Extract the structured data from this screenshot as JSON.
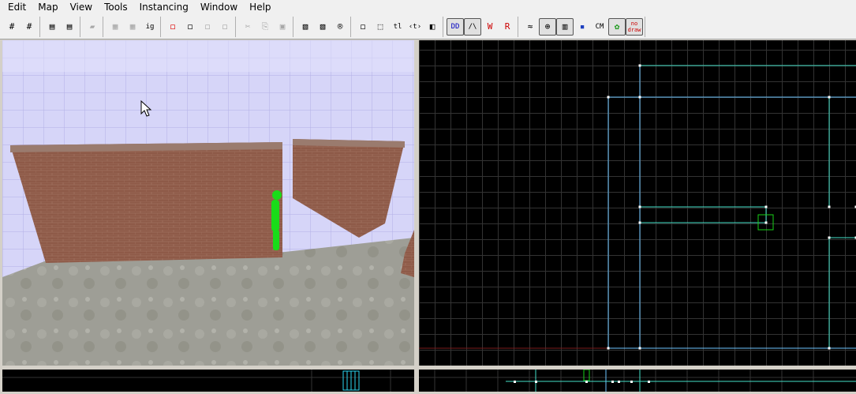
{
  "menubar": {
    "items": [
      "Edit",
      "Map",
      "View",
      "Tools",
      "Instancing",
      "Window",
      "Help"
    ]
  },
  "toolbar": {
    "groups": [
      [
        {
          "icon": "grid-toggle-icon",
          "glyph": "#",
          "state": "normal"
        },
        {
          "icon": "grid-increase-icon",
          "glyph": "#",
          "state": "normal"
        }
      ],
      [
        {
          "icon": "group-icon",
          "glyph": "▤",
          "state": "normal"
        },
        {
          "icon": "ungroup-icon",
          "glyph": "▤",
          "state": "normal"
        }
      ],
      [
        {
          "icon": "carve-icon",
          "glyph": "▰",
          "state": "disabled"
        }
      ],
      [
        {
          "icon": "hide-icon",
          "glyph": "▦",
          "state": "disabled"
        },
        {
          "icon": "unhide-icon",
          "glyph": "▦",
          "state": "disabled"
        },
        {
          "icon": "ignore-groups-icon",
          "glyph": "ig",
          "state": "normal"
        }
      ],
      [
        {
          "icon": "texture-lock-icon",
          "glyph": "◻",
          "state": "normal"
        },
        {
          "icon": "cube-icon",
          "glyph": "◻",
          "state": "normal"
        },
        {
          "icon": "tie-to-entity-icon",
          "glyph": "◻",
          "state": "disabled"
        },
        {
          "icon": "move-to-world-icon",
          "glyph": "◻",
          "state": "disabled"
        }
      ],
      [
        {
          "icon": "cut-icon",
          "glyph": "✂",
          "state": "disabled"
        },
        {
          "icon": "copy-icon",
          "glyph": "⎘",
          "state": "disabled"
        },
        {
          "icon": "paste-icon",
          "glyph": "▣",
          "state": "disabled"
        }
      ],
      [
        {
          "icon": "hazard-stripes-icon",
          "glyph": "▧",
          "state": "normal"
        },
        {
          "icon": "toggle-stripes-icon",
          "glyph": "▧",
          "state": "normal"
        },
        {
          "icon": "record-icon",
          "glyph": "®",
          "state": "normal"
        }
      ],
      [
        {
          "icon": "selection-box-icon",
          "glyph": "◻",
          "state": "normal"
        },
        {
          "icon": "dotted-select-icon",
          "glyph": "⬚",
          "state": "normal"
        },
        {
          "icon": "tl-icon",
          "glyph": "tl",
          "state": "normal"
        },
        {
          "icon": "flip-icon",
          "glyph": "‹t›",
          "state": "normal"
        },
        {
          "icon": "mirror-icon",
          "glyph": "◧",
          "state": "normal"
        }
      ],
      [
        {
          "icon": "3d-textured-icon",
          "glyph": "DD",
          "state": "pressed"
        },
        {
          "icon": "3d-wireframe-icon",
          "glyph": "/\\",
          "state": "pressed"
        },
        {
          "icon": "2d-top-icon",
          "glyph": "W",
          "state": "normal"
        },
        {
          "icon": "2d-side-icon",
          "glyph": "R",
          "state": "normal"
        }
      ],
      [
        {
          "icon": "cordon-icon",
          "glyph": "≈",
          "state": "normal"
        },
        {
          "icon": "gizmo-icon",
          "glyph": "⊕",
          "state": "pressed"
        },
        {
          "icon": "brush-icon",
          "glyph": "▥",
          "state": "pressed"
        },
        {
          "icon": "blocks-icon",
          "glyph": "▪",
          "state": "normal"
        },
        {
          "icon": "cm-icon",
          "glyph": "CM",
          "state": "normal"
        },
        {
          "icon": "leaf-icon",
          "glyph": "✿",
          "state": "pressed"
        },
        {
          "icon": "nodraw-icon",
          "glyph": "no draw",
          "state": "pressed"
        }
      ]
    ]
  },
  "colors": {
    "brick": "#8e5a48",
    "wall_sky": "#d6d5f8",
    "floor": "#9e9e96",
    "player": "#19dc19",
    "grid_fine": "#333333",
    "grid_major": "#3e3e3e",
    "brush_line": "#6ec6ff",
    "cyan_line": "#45e1c8",
    "vertex": "#ffffff",
    "red_axis": "#7a1c1c",
    "highlight_box": "#17d017"
  }
}
